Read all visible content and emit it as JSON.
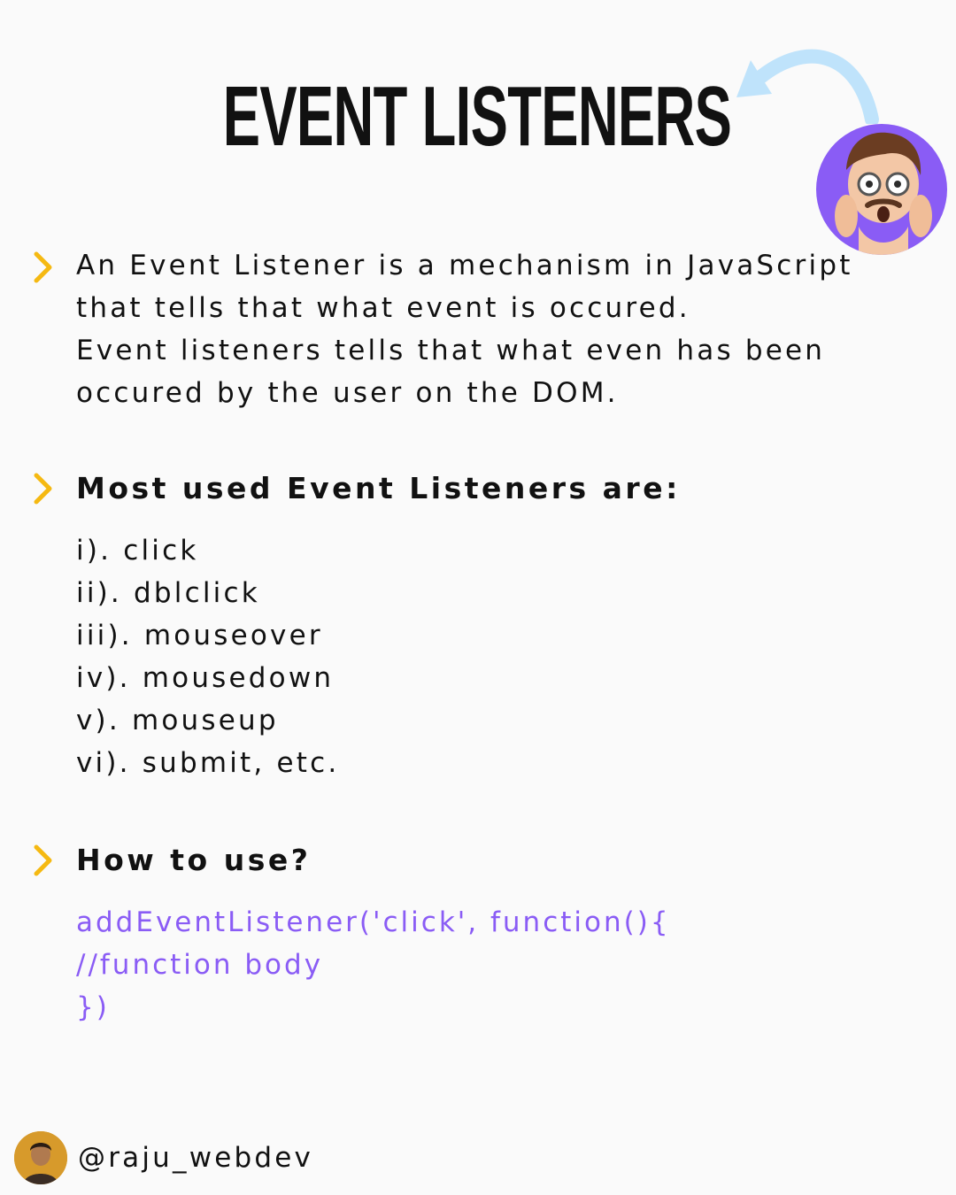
{
  "title": "EVENT LISTENERS",
  "intro": {
    "lines": [
      "An Event Listener is a mechanism in JavaScript",
      "that tells that what event is occured.",
      "Event listeners tells that what even has been",
      "occured by the user on the DOM."
    ]
  },
  "section_events": {
    "heading": "Most used Event Listeners are:",
    "items": [
      "i). click",
      "ii). dblclick",
      "iii). mouseover",
      "iv). mousedown",
      "v). mouseup",
      "vi). submit, etc."
    ]
  },
  "section_usage": {
    "heading": "How to use?",
    "code_lines": [
      "addEventListener('click', function(){",
      "//function body",
      "})"
    ]
  },
  "footer": {
    "handle": "@raju_webdev"
  },
  "icons": {
    "bullet": "chevron-right-icon",
    "decoration": "curved-arrow-icon",
    "mascot": "shocked-memoji-avatar",
    "profile": "profile-avatar"
  },
  "colors": {
    "accent_chevron": "#f5b912",
    "code": "#8a5cf5",
    "avatar_bg": "#8a5cf5",
    "arrow": "#bfe3fb"
  }
}
